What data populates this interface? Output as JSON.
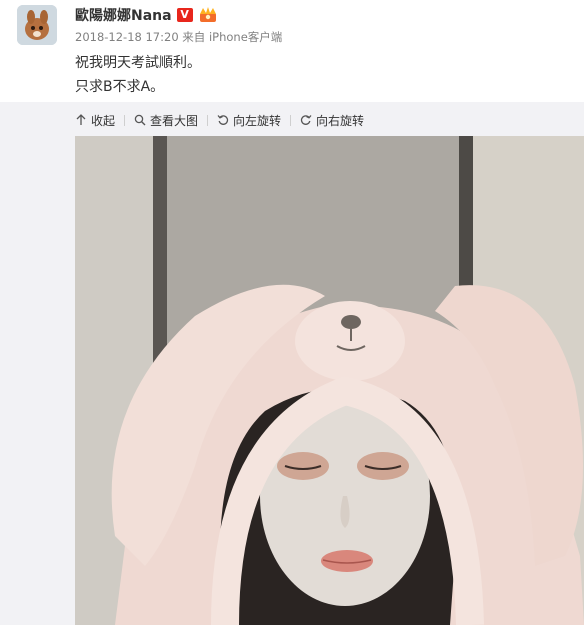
{
  "post": {
    "username": "歐陽娜娜Nana",
    "verified_badge": "V",
    "timestamp": "2018-12-18 17:20",
    "source": "来自 iPhone客户端",
    "text_line1": "祝我明天考試順利。",
    "text_line2": "只求B不求A。"
  },
  "toolbar": {
    "collapse_label": "收起",
    "view_large_label": "查看大图",
    "rotate_left_label": "向左旋转",
    "rotate_right_label": "向右旋转"
  },
  "icons": {
    "collapse": "arrow-up-icon",
    "view_large": "magnifier-icon",
    "rotate_left": "rotate-left-icon",
    "rotate_right": "rotate-right-icon",
    "crown": "crown-icon"
  },
  "colors": {
    "badge_red": "#e8261c",
    "meta_gray": "#808080",
    "media_bg": "#f2f2f5"
  }
}
